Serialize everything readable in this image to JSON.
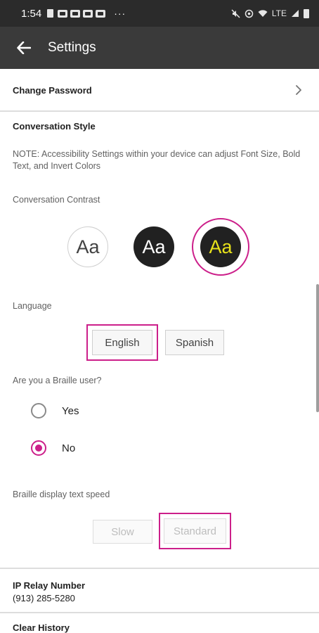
{
  "status_bar": {
    "time": "1:54",
    "more": "···",
    "lte": "LTE"
  },
  "header": {
    "title": "Settings"
  },
  "change_password": {
    "label": "Change Password"
  },
  "conversation_style": {
    "title": "Conversation Style",
    "note": "NOTE: Accessibility Settings within your device can adjust Font Size, Bold Text, and Invert Colors",
    "contrast_label": "Conversation Contrast",
    "options": [
      {
        "text": "Aa",
        "style": "light"
      },
      {
        "text": "Aa",
        "style": "dark"
      },
      {
        "text": "Aa",
        "style": "high-contrast",
        "selected": true
      }
    ]
  },
  "language": {
    "label": "Language",
    "options": [
      "English",
      "Spanish"
    ],
    "selected": "English"
  },
  "braille": {
    "question": "Are you a Braille user?",
    "options": [
      "Yes",
      "No"
    ],
    "selected": "No",
    "speed_label": "Braille display text speed",
    "speed_options": [
      "Slow",
      "Standard"
    ],
    "speed_selected": "Standard"
  },
  "ip_relay": {
    "title": "IP Relay Number",
    "number": "(913) 285-5280"
  },
  "clear_history": {
    "label": "Clear History"
  },
  "colors": {
    "accent": "#cc1f8a",
    "app_bar": "#3a3a3a",
    "status_bar": "#2b2b2b",
    "contrast_yellow": "#e8e21a"
  }
}
